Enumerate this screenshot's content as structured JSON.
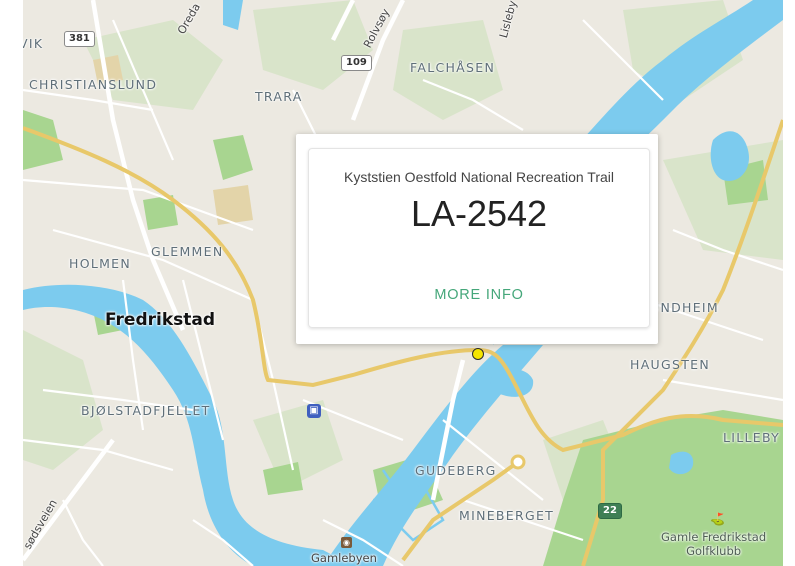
{
  "popup": {
    "subtitle": "Kyststien Oestfold National Recreation Trail",
    "title": "LA-2542",
    "more_info_label": "MORE INFO"
  },
  "map": {
    "place_labels": {
      "vik": "VIK",
      "christianslund": "CHRISTIANSLUND",
      "trara": "TRARA",
      "falchasen": "FALCHÅSEN",
      "glemmen": "GLEMMEN",
      "holmen": "HOLMEN",
      "fredrikstad": "Fredrikstad",
      "undheim": "UNDHEIM",
      "haugsten": "HAUGSTEN",
      "bjolstadfjellet": "BJØLSTADFJELLET",
      "lilleby": "LILLEBY",
      "gudeberg": "GUDEBERG",
      "mineberget": "MINEBERGET",
      "gamlebyen": "Gamlebyen"
    },
    "road_labels": {
      "oreda": "Oreda",
      "rolvsoy": "Rolvsøy",
      "lisleby": "Lisleby",
      "sodsveien": "sødsveien"
    },
    "road_shields": {
      "r381": "381",
      "r109": "109",
      "r22": "22"
    },
    "golf_course": {
      "line1": "Gamle Fredrikstad",
      "line2": "Golfklubb"
    },
    "icons": {
      "train_station": "train-station-icon",
      "golf": "golf-icon",
      "attraction": "camera-icon",
      "marker": "trail-marker-icon"
    },
    "colors": {
      "land": "#ece9e1",
      "water": "#7ccbee",
      "park": "#a4d38b",
      "forest": "#d7e3c8",
      "major_road": "#e8c86a",
      "minor_road": "#ffffff",
      "marker": "#f5e500",
      "accent": "#45a77a"
    }
  }
}
